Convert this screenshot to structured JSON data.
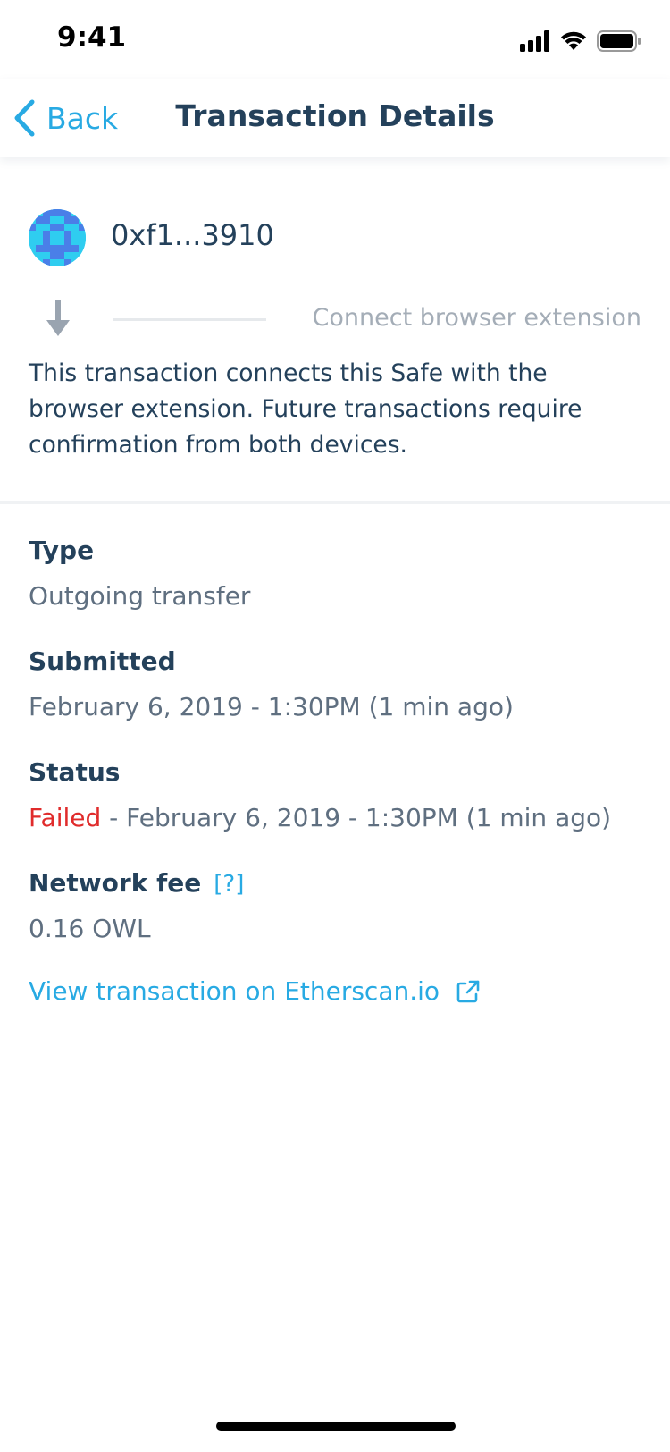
{
  "status_bar": {
    "time": "9:41",
    "icons": [
      "cellular-signal-icon",
      "wifi-icon",
      "battery-icon"
    ]
  },
  "nav": {
    "back_label": "Back",
    "title": "Transaction Details",
    "back_icon": "chevron-left-icon"
  },
  "transaction": {
    "address": "0xf1...3910",
    "action_label": "Connect browser extension",
    "description": "This transaction connects this Safe with the browser extension. Future transactions require confirmation from both devices."
  },
  "details": {
    "type_title": "Type",
    "type_value": "Outgoing transfer",
    "submitted_title": "Submitted",
    "submitted_value": "February 6, 2019 - 1:30PM (1 min ago)",
    "status_title": "Status",
    "status_failed": "Failed",
    "status_rest": " - February 6, 2019 - 1:30PM (1 min ago)",
    "fee_title": "Network fee",
    "fee_help": "[?]",
    "fee_value": "0.16 OWL"
  },
  "links": {
    "etherscan": "View transaction on Etherscan.io",
    "etherscan_icon": "external-link-icon"
  },
  "colors": {
    "accent": "#28aae3",
    "title_text": "#24415b",
    "secondary_text": "#5f6f80",
    "muted_text": "#a4adb7",
    "error": "#e02b2b",
    "identicon_bg": "#2fcdf0",
    "identicon_pattern": "#4a7fe8"
  }
}
